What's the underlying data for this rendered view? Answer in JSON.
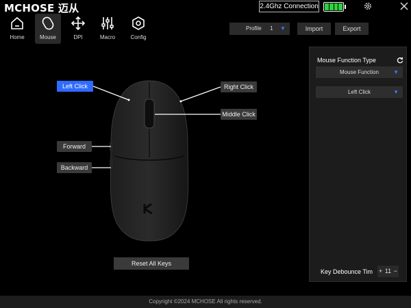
{
  "titlebar": {
    "brand": "MCHOSE 迈从",
    "connection": "2.4Ghz Connection",
    "battery_level": 1.0,
    "settings_icon": "gear-icon",
    "close_icon": "close-icon"
  },
  "nav": {
    "items": [
      {
        "label": "Home",
        "icon": "home-icon"
      },
      {
        "label": "Mouse",
        "icon": "mouse-icon"
      },
      {
        "label": "DPI",
        "icon": "move-arrows-icon"
      },
      {
        "label": "Macro",
        "icon": "sliders-icon"
      },
      {
        "label": "Config",
        "icon": "config-icon"
      }
    ],
    "active": "Mouse"
  },
  "profile": {
    "label": "Profile",
    "value": "1"
  },
  "toolbar": {
    "import_label": "Import",
    "export_label": "Export"
  },
  "buttons": {
    "left_click": "Left Click",
    "right_click": "Right Click",
    "middle_click": "Middle Click",
    "forward": "Forward",
    "backward": "Backward",
    "active": "Left Click"
  },
  "reset_label": "Reset All Keys",
  "panel": {
    "title": "Mouse Function Type",
    "function_type": "Mouse Function",
    "function_value": "Left Click",
    "debounce_label": "Key Debounce Tim",
    "debounce_value": "11"
  },
  "footer": "Copyright ©2024 MCHOSE All rights reserved.",
  "colors": {
    "accent": "#2f6bff",
    "battery": "#2fd13f",
    "background": "#000000",
    "panel": "#1c1c1c"
  }
}
